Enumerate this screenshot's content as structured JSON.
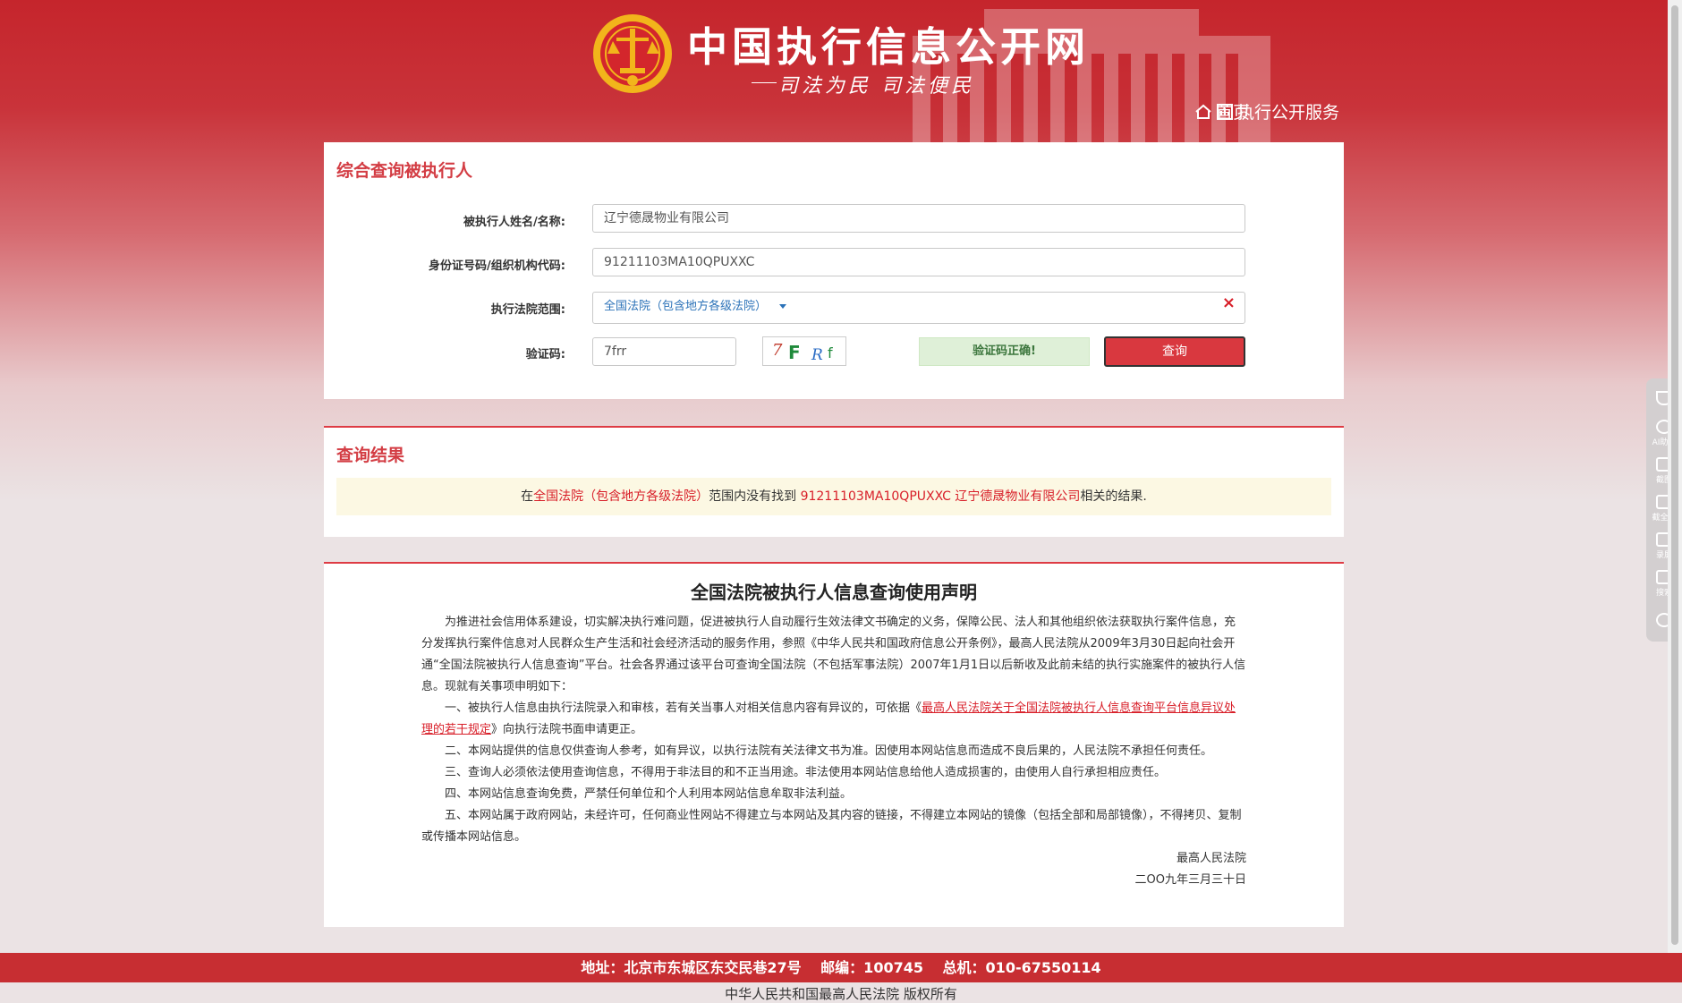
{
  "header": {
    "site_title": "中国执行信息公开网",
    "slogan": "司法为民  司法便民",
    "nav": [
      {
        "label": "首页",
        "icon": "home-icon"
      },
      {
        "label": "执行公开服务",
        "icon": "chart-icon"
      }
    ]
  },
  "query": {
    "title": "综合查询被执行人",
    "name_label": "被执行人姓名/名称:",
    "name_value": "辽宁德晟物业有限公司",
    "id_label": "身份证号码/组织机构代码:",
    "id_value": "91211103MA10QPUXXC",
    "court_label": "执行法院范围:",
    "court_value": "全国法院（包含地方各级法院）",
    "captcha_label": "验证码:",
    "captcha_value": "7frr",
    "captcha_image_text": "7FRf",
    "captcha_status": "验证码正确!",
    "query_button": "查询"
  },
  "result": {
    "title": "查询结果",
    "prefix": "在",
    "scope": "全国法院（包含地方各级法院）",
    "middle": "范围内没有找到",
    "query_terms": "91211103MA10QPUXXC 辽宁德晟物业有限公司",
    "suffix": "相关的结果."
  },
  "notice": {
    "title": "全国法院被执行人信息查询使用声明",
    "intro": "为推进社会信用体系建设，切实解决执行难问题，促进被执行人自动履行生效法律文书确定的义务，保障公民、法人和其他组织依法获取执行案件信息，充分发挥执行案件信息对人民群众生产生活和社会经济活动的服务作用，参照《中华人民共和国政府信息公开条例》，最高人民法院从2009年3月30日起向社会开通“全国法院被执行人信息查询”平台。社会各界通过该平台可查询全国法院（不包括军事法院）2007年1月1日以后新收及此前未结的执行实施案件的被执行人信息。现就有关事项申明如下：",
    "item1_before": "一、被执行人信息由执行法院录入和审核，若有关当事人对相关信息内容有异议的，可依据《",
    "item1_link": "最高人民法院关于全国法院被执行人信息查询平台信息异议处理的若干规定",
    "item1_after": "》向执行法院书面申请更正。",
    "item2": "二、本网站提供的信息仅供查询人参考，如有异议，以执行法院有关法律文书为准。因使用本网站信息而造成不良后果的，人民法院不承担任何责任。",
    "item3": "三、查询人必须依法使用查询信息，不得用于非法目的和不正当用途。非法使用本网站信息给他人造成损害的，由使用人自行承担相应责任。",
    "item4": "四、本网站信息查询免费，严禁任何单位和个人利用本网站信息牟取非法利益。",
    "item5": "五、本网站属于政府网站，未经许可，任何商业性网站不得建立与本网站及其内容的链接，不得建立本网站的镜像（包括全部和局部镜像），不得拷贝、复制或传播本网站信息。",
    "signature": "最高人民法院",
    "date": "二OO九年三月三十日"
  },
  "footer": {
    "address": "地址：北京市东城区东交民巷27号　 邮编：100745 　总机：010-67550114",
    "copyright": "中华人民共和国最高人民法院 版权所有"
  },
  "dock": [
    "AI助手",
    "截图",
    "截全屏",
    "录屏",
    "搜索"
  ],
  "colors": {
    "brand_red": "#c5252c",
    "accent_red": "#d81e28",
    "link_blue": "#2b72b8",
    "success_bg": "#dff0d8"
  }
}
